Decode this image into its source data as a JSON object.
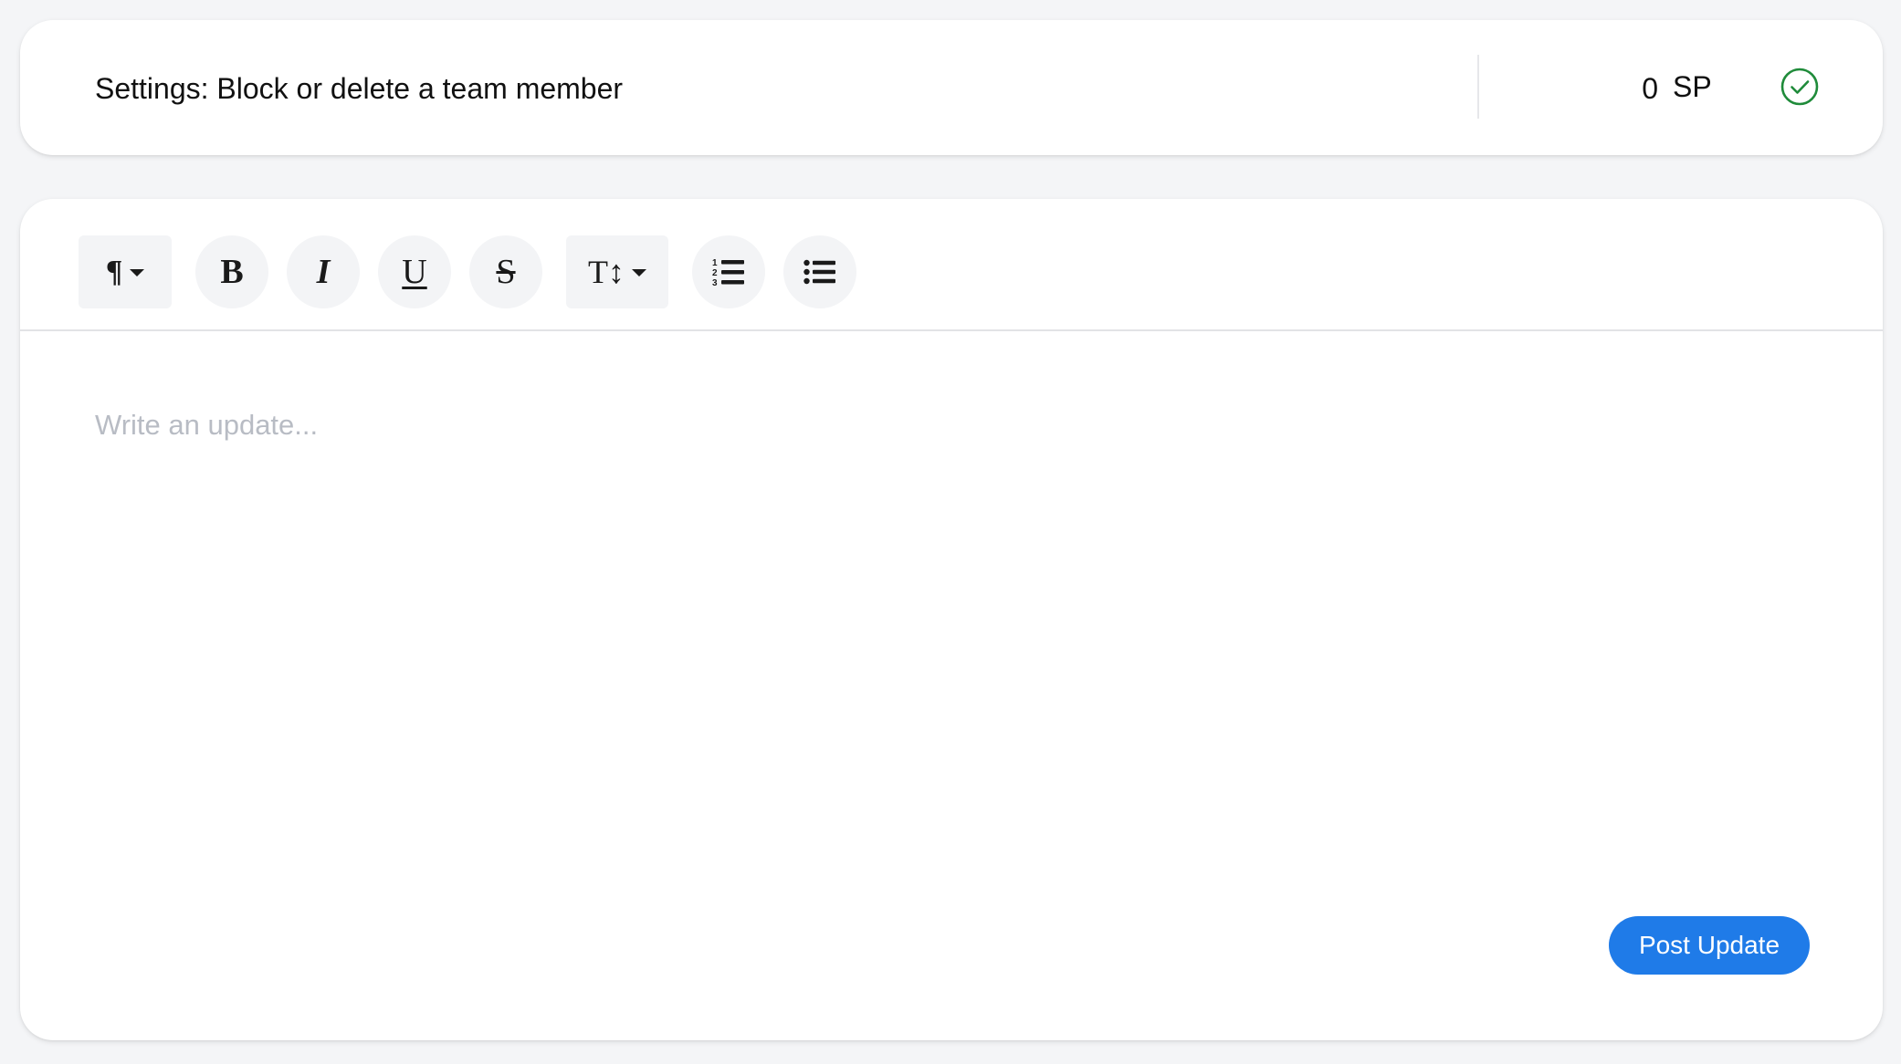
{
  "header": {
    "title": "Settings: Block or delete a team member",
    "story_points_value": "0",
    "story_points_unit": "SP",
    "status_icon": "check-circle-icon",
    "status_color": "#1f8b3a"
  },
  "toolbar": {
    "paragraph_icon": "¶",
    "bold_icon": "B",
    "italic_icon": "I",
    "underline_icon": "U",
    "strikethrough_icon": "S",
    "font_size_icon": "T↕",
    "ordered_list_icon": "ordered-list-icon",
    "unordered_list_icon": "unordered-list-icon"
  },
  "editor": {
    "placeholder": "Write an update...",
    "value": ""
  },
  "actions": {
    "post_label": "Post Update",
    "accent_color": "#1f7be8"
  }
}
